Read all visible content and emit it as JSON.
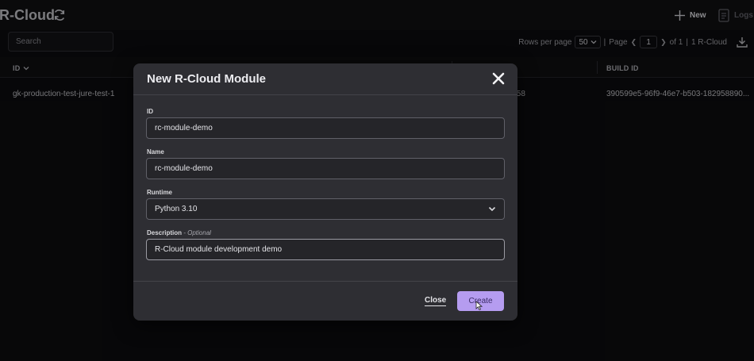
{
  "app": {
    "title": "R-Cloud"
  },
  "header": {
    "new_label": "New",
    "logs_label": "Logs"
  },
  "toolbar": {
    "search_placeholder": "Search",
    "rows_per_page_label": "Rows per page",
    "rows_per_page_value": "50",
    "page_label": "Page",
    "page_value": "1",
    "page_of": "of 1",
    "separator": "|",
    "count_label": "1 R-Cloud"
  },
  "table": {
    "columns": {
      "id": "ID",
      "build_id": "BUILD ID"
    },
    "rows": [
      {
        "id": "gk-production-test-jure-test-1",
        "mid_fragment": ":58",
        "build_id": "390599e5-96f9-46e7-b503-182958890..."
      }
    ]
  },
  "modal": {
    "title": "New R-Cloud Module",
    "fields": {
      "id": {
        "label": "ID",
        "value": "rc-module-demo"
      },
      "name": {
        "label": "Name",
        "value": "rc-module-demo"
      },
      "runtime": {
        "label": "Runtime",
        "value": "Python 3.10"
      },
      "description": {
        "label": "Description",
        "optional": "- Optional",
        "value": "R-Cloud module development demo"
      }
    },
    "close_label": "Close",
    "create_label": "Create"
  },
  "colors": {
    "accent": "#b59cf0",
    "modal_bg": "#2e2e33",
    "page_bg": "#0c0c0e"
  },
  "icons": [
    "refresh-icon",
    "plus-icon",
    "logs-icon",
    "download-icon",
    "chevron-down-icon",
    "close-icon",
    "cursor-icon"
  ]
}
